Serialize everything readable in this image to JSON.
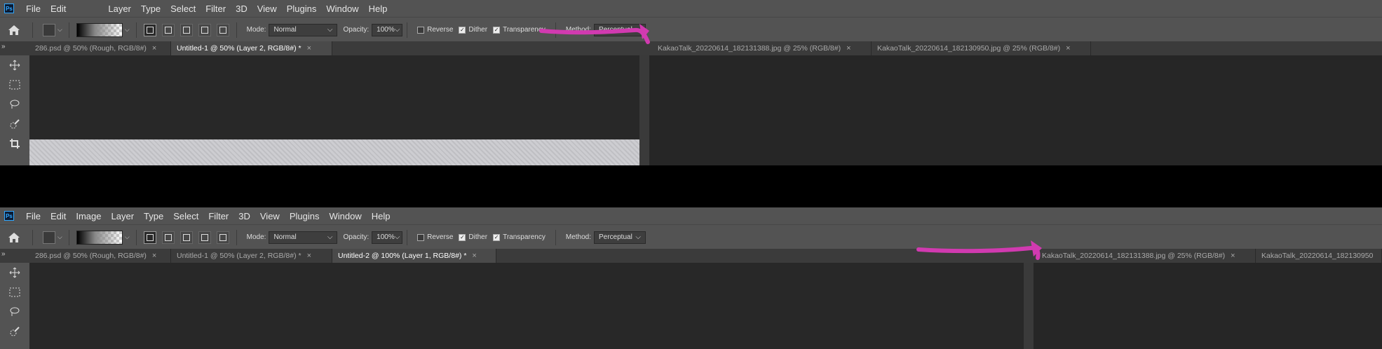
{
  "top": {
    "menu": [
      "File",
      "Edit",
      "Layer",
      "Type",
      "Select",
      "Filter",
      "3D",
      "View",
      "Plugins",
      "Window",
      "Help"
    ],
    "options": {
      "mode_label": "Mode:",
      "mode_value": "Normal",
      "opacity_label": "Opacity:",
      "opacity_value": "100%",
      "reverse_label": "Reverse",
      "dither_label": "Dither",
      "transparency_label": "Transparency",
      "method_label": "Method:",
      "method_value": "Perceptual"
    },
    "tabs": [
      {
        "label": "286.psd @ 50% (Rough, RGB/8#)"
      },
      {
        "label": "Untitled-1 @ 50% (Layer 2, RGB/8#) *"
      },
      {
        "label": "KakaoTalk_20220614_182131388.jpg @ 25% (RGB/8#)"
      },
      {
        "label": "KakaoTalk_20220614_182130950.jpg @ 25% (RGB/8#)"
      }
    ]
  },
  "bottom": {
    "menu": [
      "File",
      "Edit",
      "Image",
      "Layer",
      "Type",
      "Select",
      "Filter",
      "3D",
      "View",
      "Plugins",
      "Window",
      "Help"
    ],
    "options": {
      "mode_label": "Mode:",
      "mode_value": "Normal",
      "opacity_label": "Opacity:",
      "opacity_value": "100%",
      "reverse_label": "Reverse",
      "dither_label": "Dither",
      "transparency_label": "Transparency",
      "method_label": "Method:",
      "method_value": "Perceptual"
    },
    "tabs": [
      {
        "label": "286.psd @ 50% (Rough, RGB/8#)"
      },
      {
        "label": "Untitled-1 @ 50% (Layer 2, RGB/8#) *"
      },
      {
        "label": "Untitled-2 @ 100% (Layer 1, RGB/8#) *"
      },
      {
        "label": "KakaoTalk_20220614_182131388.jpg @ 25% (RGB/8#)"
      },
      {
        "label": "KakaoTalk_20220614_182130950"
      }
    ]
  },
  "colors": {
    "annotation": "#d13ab0",
    "ps_blue": "#31a8ff"
  }
}
